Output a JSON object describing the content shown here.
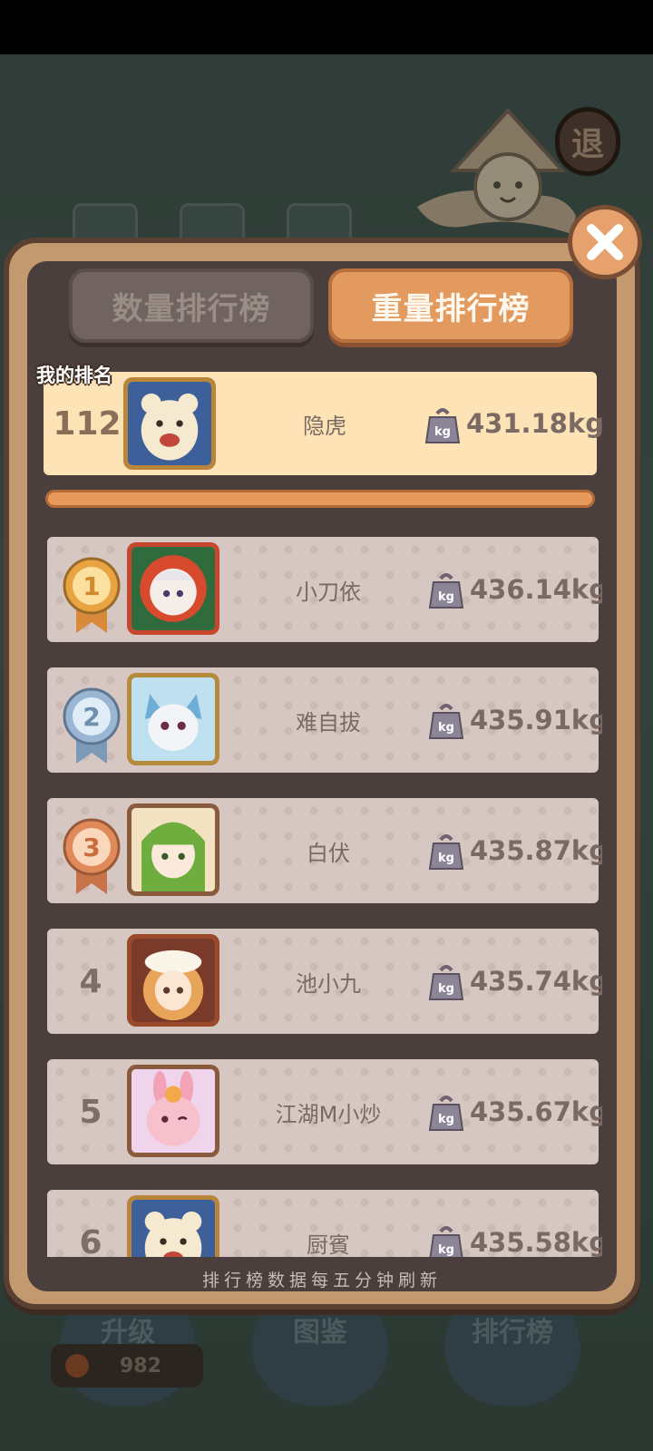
{
  "tabs": {
    "count_label": "数量排行榜",
    "weight_label": "重量排行榜",
    "active": "weight"
  },
  "exit_label": "退",
  "my_rank": {
    "label": "我的排名",
    "rank": "112",
    "name": "隐虎",
    "weight": "431.18kg"
  },
  "leaderboard": [
    {
      "rank": "1",
      "name": "小刀依",
      "weight": "436.14kg",
      "medal": "gold"
    },
    {
      "rank": "2",
      "name": "难自拔",
      "weight": "435.91kg",
      "medal": "silver"
    },
    {
      "rank": "3",
      "name": "白伏",
      "weight": "435.87kg",
      "medal": "bronze"
    },
    {
      "rank": "4",
      "name": "池小九",
      "weight": "435.74kg"
    },
    {
      "rank": "5",
      "name": "江湖M小炒",
      "weight": "435.67kg"
    },
    {
      "rank": "6",
      "name": "厨賓",
      "weight": "435.58kg"
    }
  ],
  "footer_note": "排行榜数据每五分钟刷新",
  "bottom_nav": {
    "upgrade": "升级",
    "catalog": "图鉴",
    "leaderboard": "排行榜"
  },
  "coins": "982",
  "kg_icon_text": "kg",
  "colors": {
    "accent": "#e39a5e",
    "panel": "#4b3f3d",
    "highlight_row": "#fde3b6",
    "row": "#d6c7c2"
  }
}
